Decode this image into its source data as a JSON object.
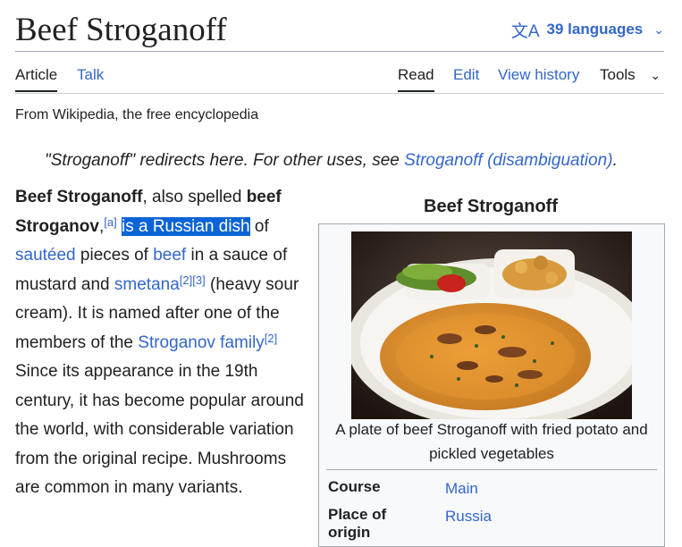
{
  "header": {
    "title": "Beef Stroganoff",
    "lang_icon": "translate-icon",
    "lang_label": "39 languages"
  },
  "tabs": {
    "article": "Article",
    "talk": "Talk",
    "read": "Read",
    "edit": "Edit",
    "history": "View history",
    "tools": "Tools"
  },
  "tagline": "From Wikipedia, the free encyclopedia",
  "hatnote": {
    "text": "\"Stroganoff\" redirects here. For other uses, see ",
    "link": "Stroganoff (disambiguation)",
    "end": "."
  },
  "lead": {
    "name": "Beef Stroganoff",
    "t1": ", also spelled ",
    "alt": "beef Stroganov",
    "t2": ",",
    "ref_a": "[a]",
    "t3": " ",
    "selected": "is a Russian dish",
    "t4": " of ",
    "link_sauteed": "sautéed",
    "t5": " pieces of ",
    "link_beef": "beef",
    "t6": " in a sauce of mustard and ",
    "link_smetana": "smetana",
    "ref_2": "[2]",
    "ref_3": "[3]",
    "t7": " (heavy sour cream). It is named after one of the members of the ",
    "link_family": "Stroganov family",
    "ref_2b": "[2]",
    "t8": " Since its appearance in the 19th century, it has become popular around the world, with considerable variation from the original recipe. Mushrooms are common in many variants."
  },
  "infobox": {
    "title": "Beef Stroganoff",
    "image_caption": "A plate of beef Stroganoff with fried potato and pickled vegetables",
    "rows": [
      {
        "label": "Course",
        "value": "Main"
      },
      {
        "label": "Place of origin",
        "value": "Russia"
      }
    ]
  },
  "colors": {
    "link": "#3366cc",
    "text": "#202122",
    "selection": "#0a64d6",
    "border": "#a2a9b1"
  }
}
